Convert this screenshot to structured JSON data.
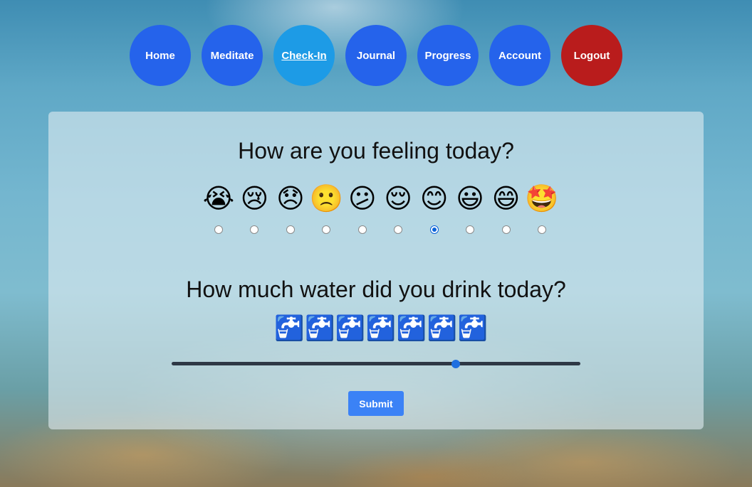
{
  "nav": {
    "items": [
      {
        "label": "Home",
        "active": false
      },
      {
        "label": "Meditate",
        "active": false
      },
      {
        "label": "Check-In",
        "active": true
      },
      {
        "label": "Journal",
        "active": false
      },
      {
        "label": "Progress",
        "active": false
      },
      {
        "label": "Account",
        "active": false
      },
      {
        "label": "Logout",
        "active": false
      }
    ],
    "colors": {
      "default": "#2563eb",
      "active": "#1d9be6",
      "logout": "#b91c1c"
    }
  },
  "mood": {
    "question": "How are you feeling today?",
    "options": [
      "😭",
      "😢",
      "😞",
      "🙁",
      "😕",
      "😌",
      "😊",
      "😃",
      "😄",
      "🤩"
    ],
    "selected_index": 6
  },
  "water": {
    "question": "How much water did you drink today?",
    "icons": [
      "🚰",
      "🚰",
      "🚰",
      "🚰",
      "🚰",
      "🚰",
      "🚰"
    ],
    "slider_fraction": 0.695
  },
  "submit_label": "Submit"
}
